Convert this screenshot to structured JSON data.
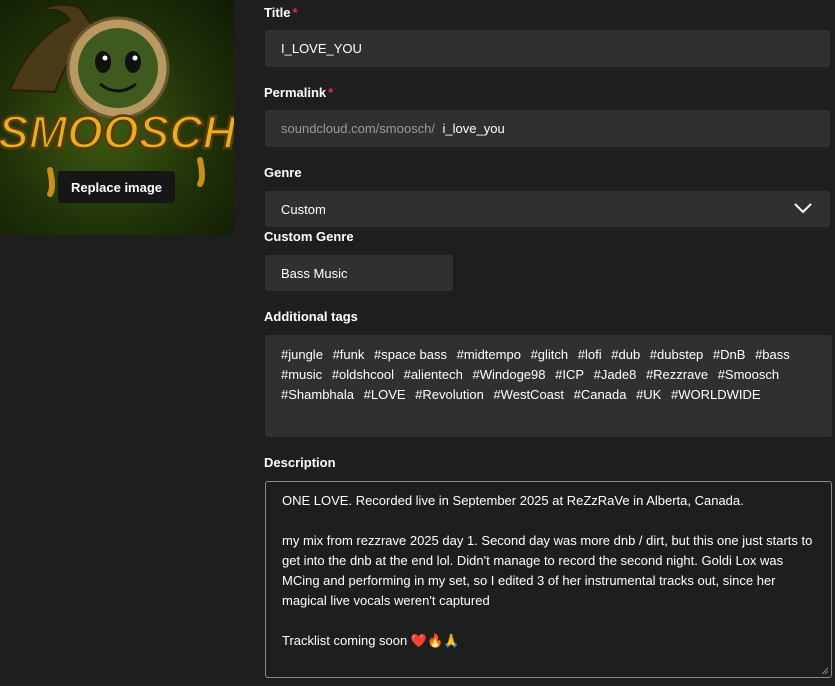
{
  "artwork": {
    "logo_text": "SMOOSCH",
    "replace_label": "Replace image"
  },
  "title": {
    "label": "Title",
    "required_mark": "*",
    "value": "I_LOVE_YOU"
  },
  "permalink": {
    "label": "Permalink",
    "required_mark": "*",
    "prefix": "soundcloud.com/smoosch/",
    "value": "i_love_you"
  },
  "genre": {
    "label": "Genre",
    "selected": "Custom",
    "icon": "chevron-down-icon"
  },
  "custom_genre": {
    "label": "Custom Genre",
    "value": "Bass Music"
  },
  "tags": {
    "label": "Additional tags",
    "items": [
      "#jungle",
      "#funk",
      "#space bass",
      "#midtempo",
      "#glitch",
      "#lofi",
      "#dub",
      "#dubstep",
      "#DnB",
      "#bass",
      "#music",
      "#oldshcool",
      "#alientech",
      "#Windoge98",
      "#ICP",
      "#Jade8",
      "#Rezzrave",
      "#Smoosch",
      "#Shambhala",
      "#LOVE",
      "#Revolution",
      "#WestCoast",
      "#Canada",
      "#UK",
      "#WORLDWIDE"
    ]
  },
  "description": {
    "label": "Description",
    "line1": "ONE LOVE. Recorded live in September 2025 at ReZzRaVe in Alberta, Canada.",
    "line2": "my mix from rezzrave 2025 day 1. Second day was more dnb / dirt, but this one just starts to get into the dnb at the end lol. Didn't manage to record the second night. Goldi Lox was MCing and performing in my set, so I edited 3 of her instrumental tracks out, since her magical live vocals weren't captured",
    "line3": "Tracklist coming soon ❤️🔥🙏"
  },
  "colors": {
    "background": "#1e1e1e",
    "field_background": "#303030",
    "required": "#e0303a",
    "logo_gold": "#e8b020",
    "logo_green": "#3f5a12"
  }
}
